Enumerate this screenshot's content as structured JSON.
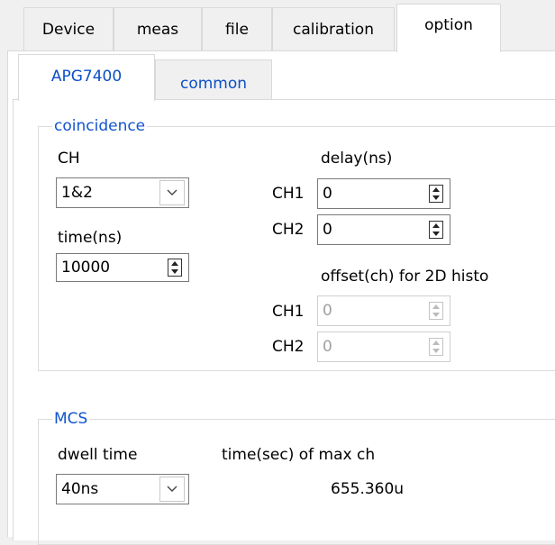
{
  "top_tabs": [
    "Device",
    "meas",
    "file",
    "calibration",
    "option"
  ],
  "sub_tabs": [
    "APG7400",
    "common"
  ],
  "coincidence": {
    "legend": "coincidence",
    "ch_label": "CH",
    "ch_value": "1&2",
    "time_label": "time(ns)",
    "time_value": "10000",
    "delay_label": "delay(ns)",
    "delay_ch1_label": "CH1",
    "delay_ch1_value": "0",
    "delay_ch2_label": "CH2",
    "delay_ch2_value": "0",
    "offset_label": "offset(ch) for 2D histo",
    "offset_ch1_label": "CH1",
    "offset_ch1_value": "0",
    "offset_ch2_label": "CH2",
    "offset_ch2_value": "0"
  },
  "mcs": {
    "legend": "MCS",
    "dwell_label": "dwell time",
    "dwell_value": "40ns",
    "max_label": "time(sec) of max ch",
    "max_value": "655.360u"
  }
}
